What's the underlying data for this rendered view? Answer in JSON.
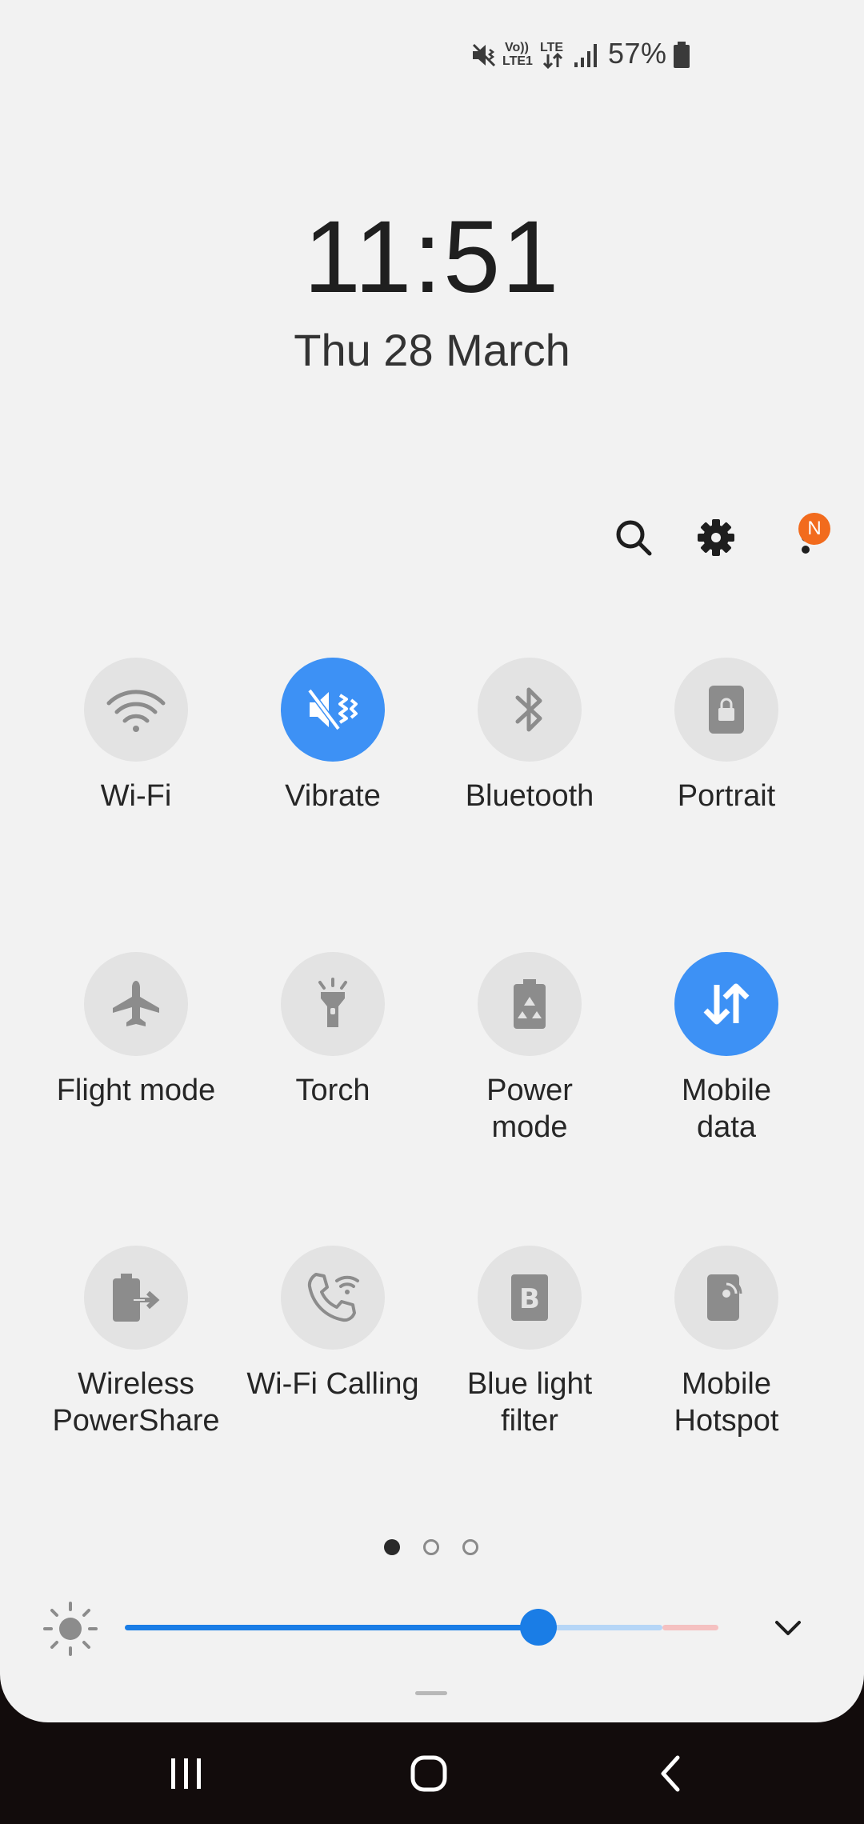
{
  "status_bar": {
    "volte_label": "Vo))",
    "lte1_label": "LTE1",
    "lte_label": "LTE",
    "battery_percent": "57%",
    "icons": [
      "mute-icon",
      "lte-data-icon",
      "signal-icon",
      "battery-icon"
    ]
  },
  "lockscreen": {
    "time": "11:51",
    "date": "Thu 28 March"
  },
  "actions": {
    "icons": [
      "search-icon",
      "gear-icon",
      "more-options-icon"
    ],
    "notification_badge": "N"
  },
  "tiles": [
    {
      "label": "Wi-Fi",
      "icon": "wifi-icon",
      "active": false
    },
    {
      "label": "Vibrate",
      "icon": "vibrate-icon",
      "active": true
    },
    {
      "label": "Bluetooth",
      "icon": "bluetooth-icon",
      "active": false
    },
    {
      "label": "Portrait",
      "icon": "portrait-lock-icon",
      "active": false
    },
    {
      "label": "Flight mode",
      "icon": "airplane-icon",
      "active": false
    },
    {
      "label": "Torch",
      "icon": "torch-icon",
      "active": false
    },
    {
      "label": "Power mode",
      "icon": "power-mode-icon",
      "active": false
    },
    {
      "label": "Mobile data",
      "icon": "mobile-data-icon",
      "active": true
    },
    {
      "label": "Wireless PowerShare",
      "icon": "wireless-powershare-icon",
      "active": false
    },
    {
      "label": "Wi-Fi Calling",
      "icon": "wifi-calling-icon",
      "active": false
    },
    {
      "label": "Blue light filter",
      "icon": "blue-light-filter-icon",
      "active": false
    },
    {
      "label": "Mobile Hotspot",
      "icon": "mobile-hotspot-icon",
      "active": false
    }
  ],
  "pager": {
    "pages": 3,
    "current": 1
  },
  "brightness": {
    "level": 0.67,
    "icon": "sun-icon",
    "expand_icon": "chevron-down-icon"
  },
  "colors": {
    "accent": "#3d91f5",
    "slider": "#1a7de6",
    "badge": "#f26b1d",
    "tile_off": "#e3e3e3"
  },
  "navigation": {
    "icons": [
      "recent-apps-icon",
      "home-icon",
      "back-icon"
    ]
  }
}
